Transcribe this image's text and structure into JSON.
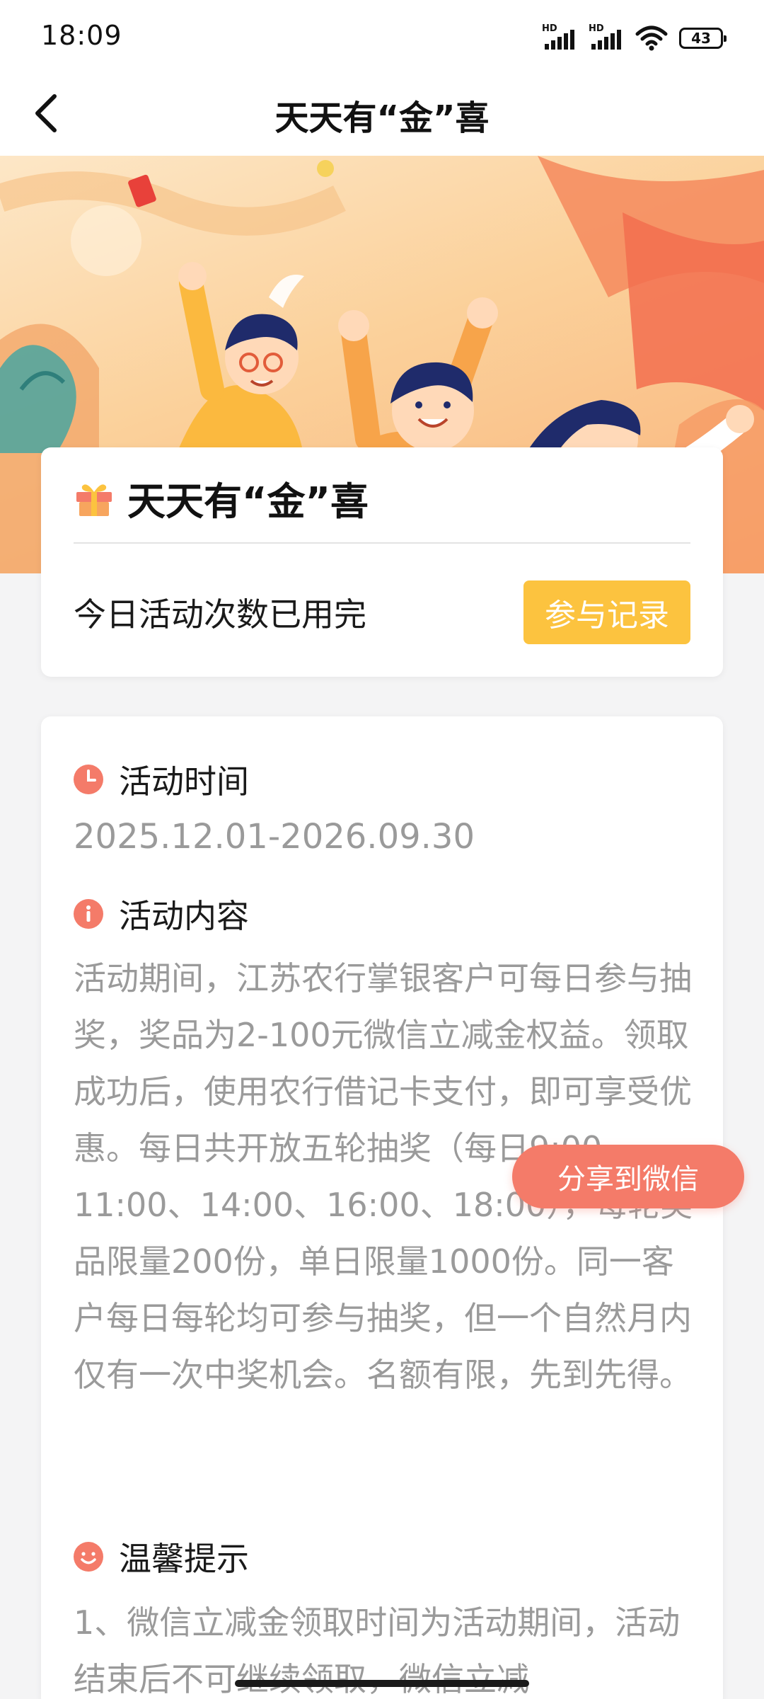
{
  "status_bar": {
    "time": "18:09",
    "network_1": "HD",
    "network_2": "HD",
    "battery": "43",
    "icons": [
      "signal-icon",
      "signal-icon",
      "wifi-icon",
      "battery-icon"
    ]
  },
  "nav": {
    "title": "天天有“金”喜",
    "back_icon": "chevron-left-icon"
  },
  "activity_card": {
    "icon": "gift-icon",
    "title": "天天有“金”喜",
    "status_text": "今日活动次数已用完",
    "record_button": "参与记录"
  },
  "details": {
    "time_section": {
      "icon": "clock-icon",
      "title": "活动时间",
      "value": "2025.12.01-2026.09.30"
    },
    "content_section": {
      "icon": "info-icon",
      "title": "活动内容",
      "text": "活动期间，江苏农行掌银客户可每日参与抽奖，奖品为2-100元微信立减金权益。领取成功后，使用农行借记卡支付，即可享受优惠。每日共开放五轮抽奖（每日9:00、11:00、14:00、16:00、18:00），每轮奖品限量200份，单日限量1000份。同一客户每日每轮均可参与抽奖，但一个自然月内仅有一次中奖机会。名额有限，先到先得。"
    },
    "tips_section": {
      "icon": "smile-icon",
      "title": "温馨提示",
      "text": "1、微信立减金领取时间为活动期间，活动结束后不可继续领取，微信立减"
    }
  },
  "share_button": "分享到微信",
  "colors": {
    "accent_yellow": "#fcc33f",
    "accent_coral": "#f47b69",
    "body_gray": "#9a9a9a"
  }
}
